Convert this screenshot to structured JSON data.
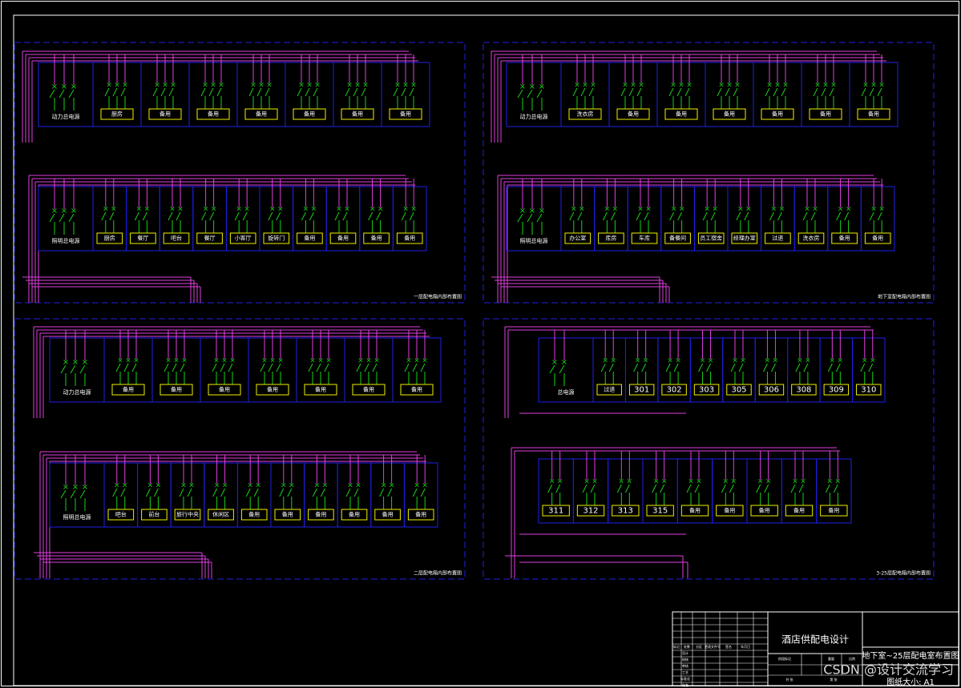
{
  "colors": {
    "background": "#000000",
    "frame": "#ffffff",
    "dash": "#1f1fe6",
    "bus": "#e040e0",
    "breaker": "#19d219",
    "label_box": "#f0f000",
    "label_text": "#ffffff"
  },
  "panels": [
    {
      "caption": "一层配电箱内部布置图",
      "rows": [
        {
          "main": "动力总电源",
          "labels": [
            "厨房",
            "备用",
            "备用",
            "备用",
            "备用",
            "备用",
            "备用"
          ]
        },
        {
          "main": "照明总电源",
          "labels": [
            "厨房",
            "餐厅",
            "吧台",
            "餐厅",
            "小客厅",
            "旋转门",
            "备用",
            "备用",
            "备用",
            "备用"
          ]
        }
      ]
    },
    {
      "caption": "地下室配电箱内部布置图",
      "rows": [
        {
          "main": "动力总电源",
          "labels": [
            "洗衣房",
            "备用",
            "备用",
            "备用",
            "备用",
            "备用",
            "备用"
          ]
        },
        {
          "main": "照明总电源",
          "labels": [
            "办公室",
            "库房",
            "车库",
            "备餐间",
            "员工宿舍",
            "经理办室",
            "过道",
            "洗衣房",
            "备用",
            "备用"
          ]
        }
      ]
    },
    {
      "caption": "二层配电箱内部布置图",
      "rows": [
        {
          "main": "动力总电源",
          "labels": [
            "备用",
            "备用",
            "备用",
            "备用",
            "备用",
            "备用",
            "备用"
          ]
        },
        {
          "main": "照明总电源",
          "labels": [
            "吧台",
            "前台",
            "旅行中央",
            "休闲区",
            "备用",
            "备用",
            "备用",
            "备用",
            "备用",
            "备用"
          ]
        }
      ]
    },
    {
      "caption": "3-25层配电箱内部布置图",
      "rows": [
        {
          "main": "总电源",
          "labels": [
            "过道",
            "301",
            "302",
            "303",
            "305",
            "306",
            "308",
            "309",
            "310"
          ]
        },
        {
          "main": "",
          "labels": [
            "311",
            "312",
            "313",
            "315",
            "备用",
            "备用",
            "备用",
            "备用",
            "备用"
          ]
        }
      ]
    }
  ],
  "title_block": {
    "project": "酒店供配电设计",
    "drawing_title": "地下室~25层配电室布置图",
    "paper_size": "图纸大小: A1",
    "rev_headers": [
      "标记",
      "处数",
      "分区",
      "更改文件号",
      "签名",
      "年月日"
    ],
    "role_labels": [
      "设计",
      "校核",
      "审核",
      "工艺",
      "标准化",
      "批准"
    ],
    "stage_label": "阶段标记",
    "weight_label": "重量",
    "scale_label": "比例",
    "sheet_total": "共 张",
    "sheet_no": "第 张"
  },
  "watermark": "CSDN @设计交流学习"
}
